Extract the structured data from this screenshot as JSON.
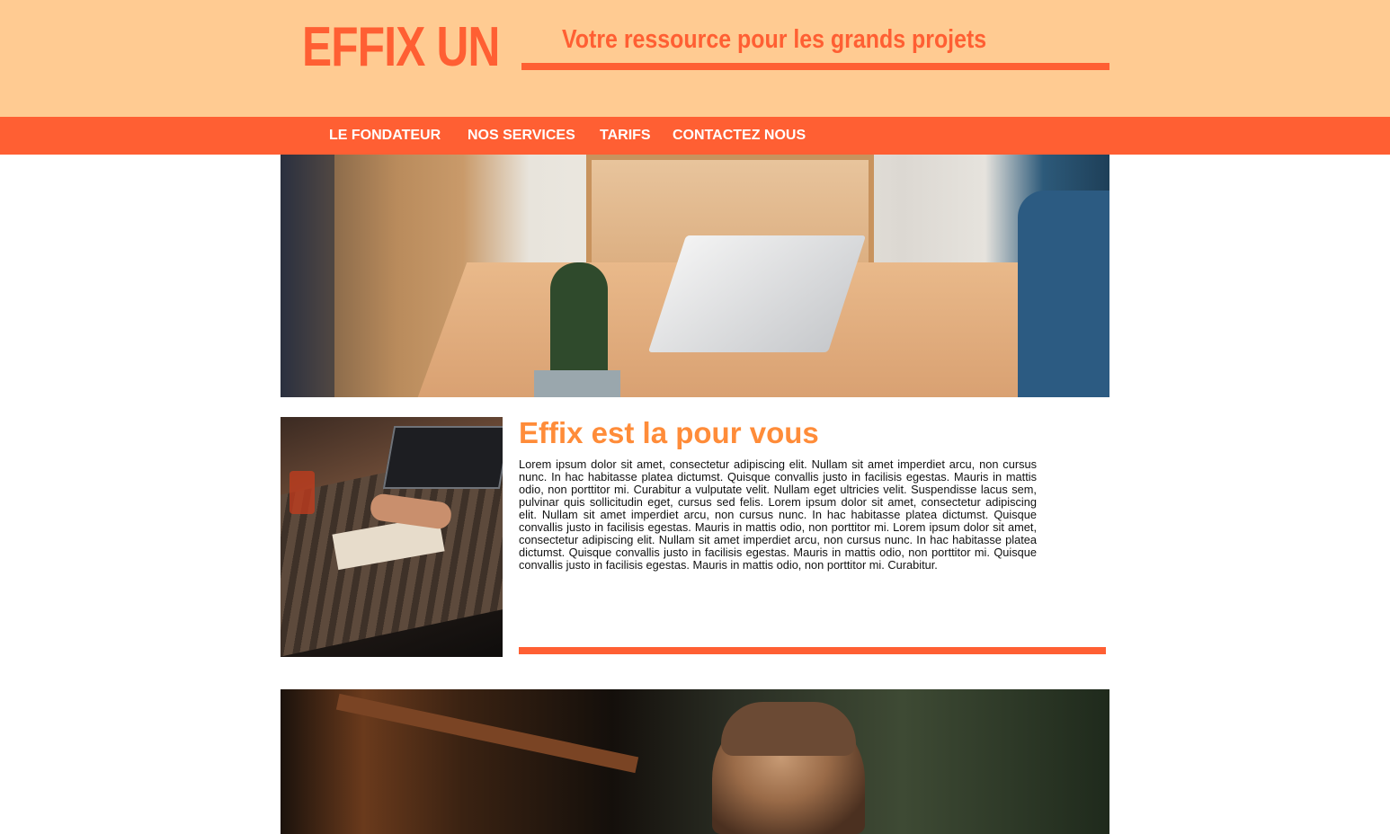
{
  "header": {
    "brand": "EFFIX UN",
    "tagline": "Votre ressource pour les grands projets"
  },
  "nav": {
    "items": [
      {
        "label": "LE FONDATEUR"
      },
      {
        "label": "NOS SERVICES"
      },
      {
        "label": "TARIFS"
      },
      {
        "label": "CONTACTEZ NOUS"
      }
    ]
  },
  "main": {
    "title": "Effix est la pour vous",
    "text": "Lorem ipsum dolor sit amet, consectetur adipiscing elit. Nullam sit amet imperdiet arcu, non cursus nunc. In hac habitasse platea dictumst. Quisque convallis justo in facilisis egestas. Mauris in mattis odio, non porttitor mi. Curabitur a vulputate velit. Nullam eget ultricies velit. Suspendisse lacus sem, pulvinar quis sollicitudin eget, cursus sed felis. Lorem ipsum dolor sit amet, consectetur adipiscing elit. Nullam sit amet imperdiet arcu, non cursus nunc. In hac habitasse platea dictumst. Quisque convallis justo in facilisis egestas. Mauris in mattis odio, non porttitor mi. Lorem ipsum dolor sit amet, consectetur adipiscing elit. Nullam sit amet imperdiet arcu, non cursus nunc. In hac habitasse platea dictumst. Quisque convallis justo in facilisis egestas. Mauris in mattis odio, non porttitor mi. Quisque convallis justo in facilisis egestas. Mauris in mattis odio, non porttitor mi. Curabitur."
  },
  "colors": {
    "header_bg": "#FFCB92",
    "accent": "#FF5F33",
    "title": "#FF8C39"
  }
}
